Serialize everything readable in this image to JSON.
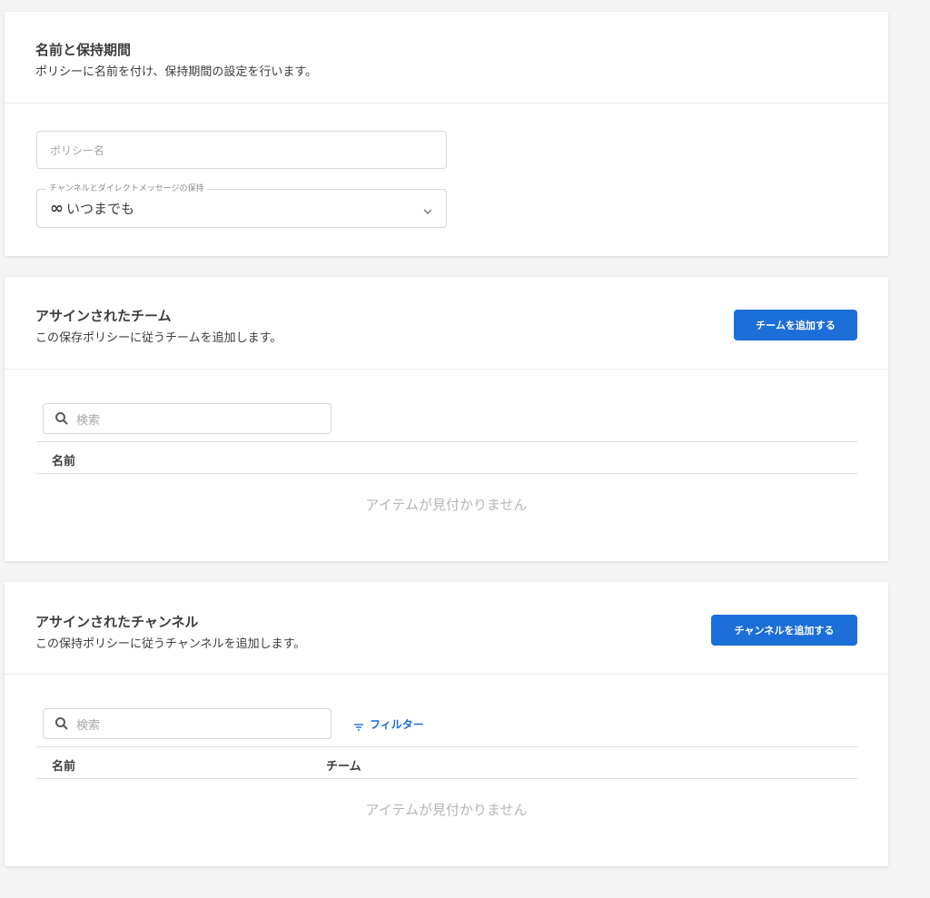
{
  "name_section": {
    "title": "名前と保持期間",
    "subtitle": "ポリシーに名前を付け、保持期間の設定を行います。",
    "policy_name_placeholder": "ポリシー名",
    "retention_label": "チャンネルとダイレクトメッセージの保持",
    "retention_icon": "infinity-icon",
    "retention_value": "いつまでも"
  },
  "teams_section": {
    "title": "アサインされたチーム",
    "subtitle": "この保存ポリシーに従うチームを追加します。",
    "add_button": "チームを追加する",
    "search_placeholder": "検索",
    "columns": [
      "名前"
    ],
    "empty_text": "アイテムが見付かりません"
  },
  "channels_section": {
    "title": "アサインされたチャンネル",
    "subtitle": "この保持ポリシーに従うチャンネルを追加します。",
    "add_button": "チャンネルを追加する",
    "search_placeholder": "検索",
    "filter_label": "フィルター",
    "columns": [
      "名前",
      "チーム"
    ],
    "empty_text": "アイテムが見付かりません"
  },
  "colors": {
    "accent": "#1c6ed8",
    "background": "#f4f4f4"
  }
}
